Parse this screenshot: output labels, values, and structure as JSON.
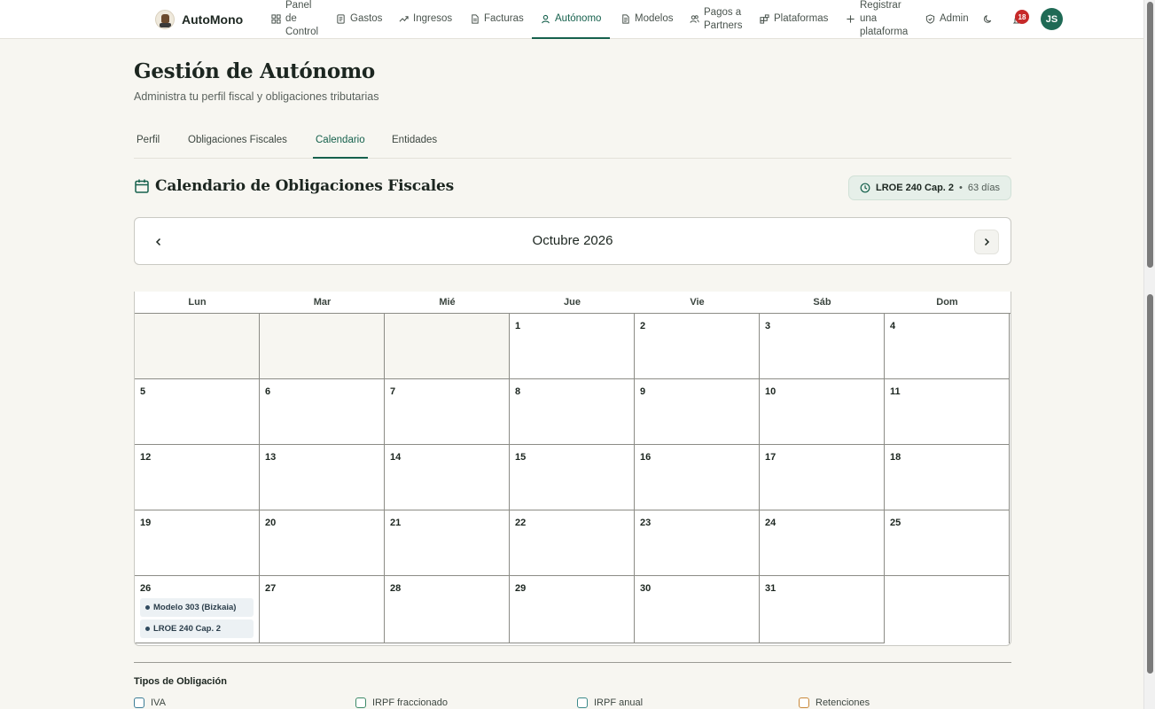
{
  "brand": {
    "name": "AutoMono"
  },
  "nav": {
    "items": [
      {
        "label": "Panel de Control",
        "lines": [
          "Panel",
          "de",
          "Control"
        ]
      },
      {
        "label": "Gastos"
      },
      {
        "label": "Ingresos"
      },
      {
        "label": "Facturas"
      },
      {
        "label": "Autónomo"
      },
      {
        "label": "Modelos"
      },
      {
        "label": "Pagos a Partners",
        "lines": [
          "Pagos a",
          "Partners"
        ]
      },
      {
        "label": "Plataformas"
      },
      {
        "label": "Registrar una plataforma",
        "lines": [
          "Registrar",
          "una",
          "plataforma"
        ]
      },
      {
        "label": "Admin"
      }
    ],
    "active": "Autónomo",
    "notifications": "18",
    "avatar_initials": "JS"
  },
  "page": {
    "title": "Gestión de Autónomo",
    "subtitle": "Administra tu perfil fiscal y obligaciones tributarias"
  },
  "tabs": [
    {
      "label": "Perfil"
    },
    {
      "label": "Obligaciones Fiscales"
    },
    {
      "label": "Calendario"
    },
    {
      "label": "Entidades"
    }
  ],
  "calendar_section": {
    "title": "Calendario de Obligaciones Fiscales",
    "next_deadline": {
      "name": "LROE 240 Cap. 2",
      "separator": "•",
      "days": "63 días"
    }
  },
  "calendar": {
    "month_label": "Octubre 2026",
    "weekdays": [
      "Lun",
      "Mar",
      "Mié",
      "Jue",
      "Vie",
      "Sáb",
      "Dom"
    ],
    "weeks": [
      [
        "",
        "",
        "",
        "1",
        "2",
        "3",
        "4"
      ],
      [
        "5",
        "6",
        "7",
        "8",
        "9",
        "10",
        "11"
      ],
      [
        "12",
        "13",
        "14",
        "15",
        "16",
        "17",
        "18"
      ],
      [
        "19",
        "20",
        "21",
        "22",
        "23",
        "24",
        "25"
      ],
      [
        "26",
        "27",
        "28",
        "29",
        "30",
        "31",
        ""
      ]
    ],
    "events": [
      {
        "day": "26",
        "items": [
          "Modelo 303 (Bizkaia)",
          "LROE 240 Cap. 2"
        ]
      }
    ]
  },
  "legend": {
    "title": "Tipos de Obligación",
    "items": [
      {
        "label": "IVA",
        "color": "#3c7d96"
      },
      {
        "label": "IRPF fraccionado",
        "color": "#3d8a68"
      },
      {
        "label": "IRPF anual",
        "color": "#3c8a8a"
      },
      {
        "label": "Retenciones",
        "color": "#c9893a"
      }
    ]
  },
  "colors": {
    "accent": "#16614d",
    "badge": "#c62a2a",
    "background": "#f7f6f1"
  }
}
